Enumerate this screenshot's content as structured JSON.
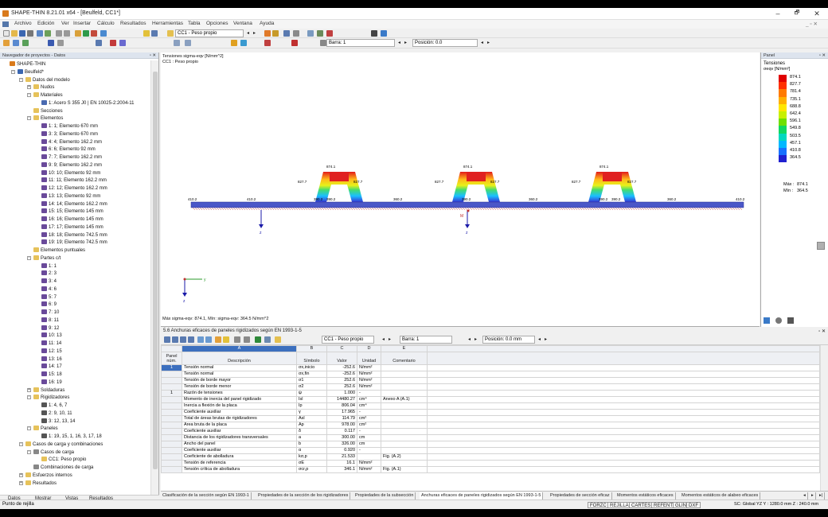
{
  "app": {
    "title": "SHAPE-THIN 8.21.01 x64 - [Beulfeld, CC1*]",
    "win_minimize": "–",
    "win_restore": "🗗",
    "win_close": "✕",
    "doc_controls": "_ ▫ ✕"
  },
  "menu": [
    "Archivo",
    "Edición",
    "Ver",
    "Insertar",
    "Cálculo",
    "Resultados",
    "Herramientas",
    "Tabla",
    "Opciones",
    "Ventana",
    "Ayuda"
  ],
  "toolbar": {
    "loadcase": "CC1 - Peso propio",
    "bar_label": "Barra: 1",
    "position_label": "Posición: 0.0"
  },
  "nav": {
    "header": "Navegador de proyectos - Datos",
    "header_controls": "▫ ✕",
    "tree": [
      {
        "label": "SHAPE-THIN",
        "indent": 0,
        "icon": "app",
        "exp": ""
      },
      {
        "label": "Beulfeld*",
        "indent": 1,
        "icon": "proj",
        "exp": "-"
      },
      {
        "label": "Datos del modelo",
        "indent": 2,
        "icon": "fold",
        "exp": "-"
      },
      {
        "label": "Nudos",
        "indent": 3,
        "icon": "fold",
        "exp": "+"
      },
      {
        "label": "Materiales",
        "indent": 3,
        "icon": "fold",
        "exp": "-"
      },
      {
        "label": "1: Acero S 355 J0 | EN 10025-2:2004-11",
        "indent": 4,
        "icon": "mat",
        "exp": ""
      },
      {
        "label": "Secciones",
        "indent": 3,
        "icon": "fold",
        "exp": ""
      },
      {
        "label": "Elementos",
        "indent": 3,
        "icon": "fold",
        "exp": "-"
      },
      {
        "label": "1: 1; Elemento 670 mm",
        "indent": 4,
        "icon": "elem",
        "exp": ""
      },
      {
        "label": "3: 3; Elemento 670 mm",
        "indent": 4,
        "icon": "elem",
        "exp": ""
      },
      {
        "label": "4: 4; Elemento 162.2 mm",
        "indent": 4,
        "icon": "elem",
        "exp": ""
      },
      {
        "label": "6: 6; Elemento 92 mm",
        "indent": 4,
        "icon": "elem",
        "exp": ""
      },
      {
        "label": "7: 7; Elemento 162.2 mm",
        "indent": 4,
        "icon": "elem",
        "exp": ""
      },
      {
        "label": "9: 9; Elemento 162.2 mm",
        "indent": 4,
        "icon": "elem",
        "exp": ""
      },
      {
        "label": "10: 10; Elemento 92 mm",
        "indent": 4,
        "icon": "elem",
        "exp": ""
      },
      {
        "label": "11: 11; Elemento 162.2 mm",
        "indent": 4,
        "icon": "elem",
        "exp": ""
      },
      {
        "label": "12: 12; Elemento 162.2 mm",
        "indent": 4,
        "icon": "elem",
        "exp": ""
      },
      {
        "label": "13: 13; Elemento 92 mm",
        "indent": 4,
        "icon": "elem",
        "exp": ""
      },
      {
        "label": "14: 14; Elemento 162.2 mm",
        "indent": 4,
        "icon": "elem",
        "exp": ""
      },
      {
        "label": "15: 15; Elemento 145 mm",
        "indent": 4,
        "icon": "elem",
        "exp": ""
      },
      {
        "label": "16: 16; Elemento 145 mm",
        "indent": 4,
        "icon": "elem",
        "exp": ""
      },
      {
        "label": "17: 17; Elemento 145 mm",
        "indent": 4,
        "icon": "elem",
        "exp": ""
      },
      {
        "label": "18: 18; Elemento 742.5 mm",
        "indent": 4,
        "icon": "elem",
        "exp": ""
      },
      {
        "label": "19: 19; Elemento 742.5 mm",
        "indent": 4,
        "icon": "elem",
        "exp": ""
      },
      {
        "label": "Elementos puntuales",
        "indent": 3,
        "icon": "fold",
        "exp": ""
      },
      {
        "label": "Partes c/t",
        "indent": 3,
        "icon": "fold",
        "exp": "-"
      },
      {
        "label": "1: 1",
        "indent": 4,
        "icon": "elem",
        "exp": ""
      },
      {
        "label": "2: 3",
        "indent": 4,
        "icon": "elem",
        "exp": ""
      },
      {
        "label": "3: 4",
        "indent": 4,
        "icon": "elem",
        "exp": ""
      },
      {
        "label": "4: 6",
        "indent": 4,
        "icon": "elem",
        "exp": ""
      },
      {
        "label": "5: 7",
        "indent": 4,
        "icon": "elem",
        "exp": ""
      },
      {
        "label": "6: 9",
        "indent": 4,
        "icon": "elem",
        "exp": ""
      },
      {
        "label": "7: 10",
        "indent": 4,
        "icon": "elem",
        "exp": ""
      },
      {
        "label": "8: 11",
        "indent": 4,
        "icon": "elem",
        "exp": ""
      },
      {
        "label": "9: 12",
        "indent": 4,
        "icon": "elem",
        "exp": ""
      },
      {
        "label": "10: 13",
        "indent": 4,
        "icon": "elem",
        "exp": ""
      },
      {
        "label": "11: 14",
        "indent": 4,
        "icon": "elem",
        "exp": ""
      },
      {
        "label": "12: 15",
        "indent": 4,
        "icon": "elem",
        "exp": ""
      },
      {
        "label": "13: 16",
        "indent": 4,
        "icon": "elem",
        "exp": ""
      },
      {
        "label": "14: 17",
        "indent": 4,
        "icon": "elem",
        "exp": ""
      },
      {
        "label": "15: 18",
        "indent": 4,
        "icon": "elem",
        "exp": ""
      },
      {
        "label": "16: 19",
        "indent": 4,
        "icon": "elem",
        "exp": ""
      },
      {
        "label": "Soldaduras",
        "indent": 3,
        "icon": "fold",
        "exp": "+"
      },
      {
        "label": "Rigidizadores",
        "indent": 3,
        "icon": "fold",
        "exp": "-"
      },
      {
        "label": "1: 4, 6, 7",
        "indent": 4,
        "icon": "stif",
        "exp": ""
      },
      {
        "label": "2: 9, 10, 11",
        "indent": 4,
        "icon": "stif",
        "exp": ""
      },
      {
        "label": "3: 12, 13, 14",
        "indent": 4,
        "icon": "stif",
        "exp": ""
      },
      {
        "label": "Paneles",
        "indent": 3,
        "icon": "fold",
        "exp": "-"
      },
      {
        "label": "1: 19, 15, 1, 16, 3, 17, 18",
        "indent": 4,
        "icon": "stif",
        "exp": ""
      },
      {
        "label": "Casos de carga y combinaciones",
        "indent": 2,
        "icon": "fold",
        "exp": "-"
      },
      {
        "label": "Casos de carga",
        "indent": 3,
        "icon": "lc",
        "exp": "-"
      },
      {
        "label": "CC1: Peso propio",
        "indent": 4,
        "icon": "fold",
        "exp": ""
      },
      {
        "label": "Combinaciones de carga",
        "indent": 3,
        "icon": "lc",
        "exp": ""
      },
      {
        "label": "Esfuerzos internos",
        "indent": 2,
        "icon": "fold",
        "exp": "+"
      },
      {
        "label": "Resultados",
        "indent": 2,
        "icon": "fold",
        "exp": "+"
      }
    ]
  },
  "navtabs": [
    "Datos",
    "Mostrar",
    "Vistas",
    "Resultados"
  ],
  "view": {
    "title": "Tensiones sigma-eqv [N/mm^2]",
    "subtitle": "CC1 : Peso propio",
    "maxmin": "Máx sigma-eqv: 874.1, Mín: sigma-eqv: 364.5 N/mm^2",
    "labels": {
      "v874": "874.1",
      "v827": "827.7",
      "v802": "802.2",
      "v410": "410.2",
      "v364": "364.5",
      "v360": "360.2",
      "v3902": "390.2",
      "z": "z",
      "y": "y",
      "m": "M"
    },
    "colors": {
      "beam": "#4b57c8",
      "red": "#e02020",
      "hatch": "#c04040"
    }
  },
  "panel": {
    "header": "Panel",
    "header_controls": "▫ ✕",
    "title": "Tensiones",
    "unit": "σeqv [N/mm²]",
    "legend": [
      "874.1",
      "827.7",
      "781.4",
      "735.1",
      "688.8",
      "642.4",
      "596.1",
      "549.8",
      "503.5",
      "457.1",
      "410.8",
      "364.5"
    ],
    "max_label": "Máx :",
    "max_val": "874.1",
    "min_label": "Mín :",
    "min_val": "364.5",
    "legend_colors": [
      "#e00000",
      "#ff3000",
      "#ff7a00",
      "#ffb000",
      "#ffe600",
      "#c8f000",
      "#6ee000",
      "#10d860",
      "#00d8c0",
      "#00b8ff",
      "#1870ff",
      "#2020d0"
    ]
  },
  "table": {
    "title": "5.6 Anchuras eficaces de paneles rigidizados según EN 1993-1-5",
    "title_controls": "▫ ✕",
    "loadcase": "CC1 - Peso propio",
    "bar": "Barra: 1",
    "position": "Posición: 0.0 mm",
    "col_letters": [
      "A",
      "B",
      "C",
      "D",
      "E"
    ],
    "headers": {
      "panel": "Panel núm.",
      "desc": "Descripción",
      "sym": "Símbolo",
      "val": "Valor",
      "unit": "Unidad",
      "com": "Comentario"
    },
    "rows": [
      {
        "p": "1",
        "d": "Tensión normal",
        "s": "σx,inicio",
        "v": "-252.6",
        "u": "N/mm²",
        "c": "",
        "sel": true
      },
      {
        "p": "",
        "d": "Tensión normal",
        "s": "σx,fin",
        "v": "-252.6",
        "u": "N/mm²",
        "c": ""
      },
      {
        "p": "",
        "d": "Tensión de borde mayor",
        "s": "σ1",
        "v": "252.6",
        "u": "N/mm²",
        "c": ""
      },
      {
        "p": "",
        "d": "Tensión de borde menor",
        "s": "σ2",
        "v": "252.6",
        "u": "N/mm²",
        "c": ""
      },
      {
        "p": "1",
        "d": "Razón de tensiones",
        "s": "ψ",
        "v": "1.000",
        "u": "-",
        "c": ""
      },
      {
        "p": "",
        "d": "Momento de inercia del panel rigidizado",
        "s": "Isl",
        "v": "14480.27",
        "u": "cm⁴",
        "c": "Anexo A (A.1)"
      },
      {
        "p": "",
        "d": "Inercia a flexión de la placa",
        "s": "Ip",
        "v": "806.04",
        "u": "cm⁴",
        "c": ""
      },
      {
        "p": "",
        "d": "Coeficiente auxiliar",
        "s": "γ",
        "v": "17.965",
        "u": "-",
        "c": ""
      },
      {
        "p": "",
        "d": "Total de áreas brutas de rigidizadores",
        "s": "Asl",
        "v": "114.79",
        "u": "cm²",
        "c": ""
      },
      {
        "p": "",
        "d": "Área bruta de la placa",
        "s": "Ap",
        "v": "978.00",
        "u": "cm²",
        "c": ""
      },
      {
        "p": "",
        "d": "Coeficiente auxiliar",
        "s": "δ",
        "v": "0.117",
        "u": "-",
        "c": ""
      },
      {
        "p": "",
        "d": "Distancia de los rigidizadores transversales",
        "s": "a",
        "v": "300.00",
        "u": "cm",
        "c": ""
      },
      {
        "p": "",
        "d": "Ancho del panel",
        "s": "b",
        "v": "326.00",
        "u": "cm",
        "c": ""
      },
      {
        "p": "",
        "d": "Coeficiente auxiliar",
        "s": "α",
        "v": "0.920",
        "u": "-",
        "c": ""
      },
      {
        "p": "",
        "d": "Coeficiente de abolladura",
        "s": "kσ,p",
        "v": "21.533",
        "u": "",
        "c": "Fig. (A.2)"
      },
      {
        "p": "",
        "d": "Tensión de referencia",
        "s": "σE",
        "v": "16.1",
        "u": "N/mm²",
        "c": ""
      },
      {
        "p": "",
        "d": "Tensión crítica de abolladura",
        "s": "σcr,p",
        "v": "346.1",
        "u": "N/mm²",
        "c": "Fig. (A.1)"
      }
    ]
  },
  "sheettabs": [
    "Clasificación de la sección según EN 1993-1",
    "Propiedades de la sección de los rigidizadores",
    "Propiedades de la subsección",
    "Anchuras eficaces de paneles rigidizados según EN 1993-1-5",
    "Propiedades de sección eficaz",
    "Momentos estáticos eficaces",
    "Momentos estáticos de alabeo eficaces"
  ],
  "status": {
    "left": "Punto de rejilla",
    "buttons": [
      "FORZC",
      "REJILLA",
      "CARTES",
      "REFENT",
      "GLIN",
      "DXF"
    ],
    "right": "SC: Global YZ Y : 1280.0 mm Z : 240.0 mm"
  }
}
